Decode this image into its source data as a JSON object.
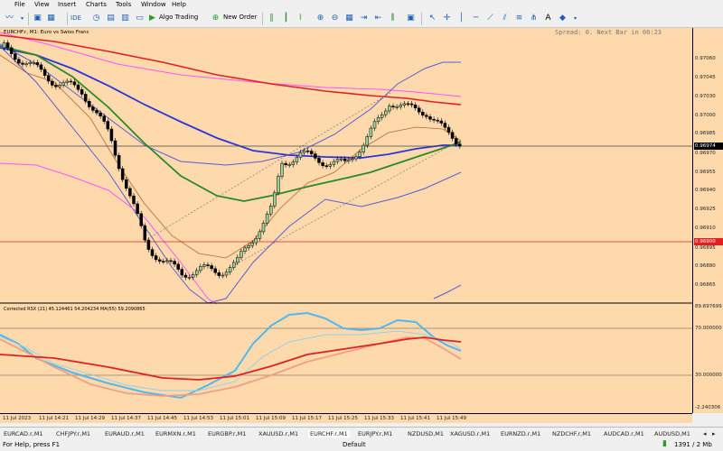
{
  "menu": [
    "File",
    "View",
    "Insert",
    "Charts",
    "Tools",
    "Window",
    "Help"
  ],
  "toolbar": {
    "ide": "IDE",
    "algo_trading": "Algo Trading",
    "new_order": "New Order"
  },
  "chart": {
    "title": "EURCHF.r, M1:  Euro vs Swiss Franc",
    "spread_text": "Spread: 0.  Next Bar in 00:23",
    "price_labels": [
      "0.97060",
      "0.97045",
      "0.97030",
      "0.97015",
      "0.97000",
      "0.96985",
      "0.96970",
      "0.96955",
      "0.96940",
      "0.96925",
      "0.96910",
      "0.96895",
      "0.96880",
      "0.96865"
    ],
    "current_price_tag": "0.96974",
    "red_line_tag": "0.96900",
    "rsi_info": "Corrected RSX (21) 45.124461 54.204234 MA(55) 59.2090865",
    "rsi_labels": [
      "89.697699",
      "70.000000",
      "30.000000",
      "-2.240306"
    ],
    "time_labels": [
      "11 Jul 2023",
      "11 Jul 14:21",
      "11 Jul 14:29",
      "11 Jul 14:37",
      "11 Jul 14:45",
      "11 Jul 14:53",
      "11 Jul 15:01",
      "11 Jul 15:09",
      "11 Jul 15:17",
      "11 Jul 15:25",
      "11 Jul 15:33",
      "11 Jul 15:41",
      "11 Jul 15:49"
    ],
    "colors": {
      "background": "#fdd9ab",
      "ma_red": "#e02020",
      "ma_blue": "#2a35e0",
      "ma_green": "#2a8a2a",
      "band_pink": "#ff55ff",
      "band_violet": "#5b5bd6",
      "rsx_line": "#4fb8f0"
    }
  },
  "tabs": [
    "EURCAD.r,M1",
    "CHFJPY.r,M1",
    "EURAUD.r,M1",
    "EURMXN.r,M1",
    "EURGBP.r,M1",
    "XAUUSD.r,M1",
    "EURCHF.r,M1",
    "EURJPY.r,M1",
    "NZDUSD,M1",
    "XAGUSD.r,M1",
    "EURNZD.r,M1",
    "NZDCHF.r,M1",
    "AUDCAD.r,M1",
    "AUDUSD,M1"
  ],
  "status": {
    "help": "For Help, press F1",
    "profile": "Default",
    "traffic": "1391 / 2 Mb"
  }
}
